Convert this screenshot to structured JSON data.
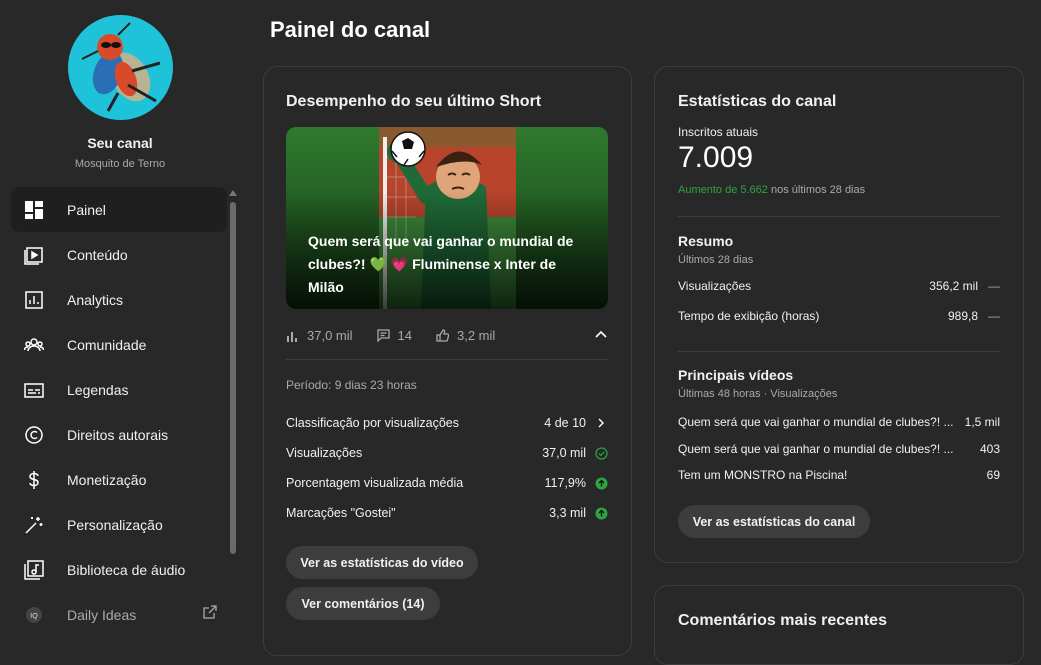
{
  "sidebar": {
    "channel_name": "Seu canal",
    "channel_handle": "Mosquito de Terno",
    "items": [
      {
        "label": "Painel",
        "icon": "dashboard-icon",
        "active": true
      },
      {
        "label": "Conteúdo",
        "icon": "content-icon"
      },
      {
        "label": "Analytics",
        "icon": "analytics-icon"
      },
      {
        "label": "Comunidade",
        "icon": "community-icon"
      },
      {
        "label": "Legendas",
        "icon": "subtitles-icon"
      },
      {
        "label": "Direitos autorais",
        "icon": "copyright-icon"
      },
      {
        "label": "Monetização",
        "icon": "dollar-icon"
      },
      {
        "label": "Personalização",
        "icon": "magic-wand-icon"
      },
      {
        "label": "Biblioteca de áudio",
        "icon": "audio-library-icon"
      },
      {
        "label": "Daily Ideas",
        "icon": "daily-ideas-icon",
        "external": true
      }
    ]
  },
  "page": {
    "title": "Painel do canal"
  },
  "short_card": {
    "title": "Desempenho do seu último Short",
    "thumbnail_caption": "Quem será que vai ganhar o mundial de clubes?! 💚 💗 Fluminense x Inter de Milão",
    "views": "37,0 mil",
    "comments": "14",
    "likes": "3,2 mil",
    "period": "Período: 9 dias 23 horas",
    "stats": [
      {
        "label": "Classificação por visualizações",
        "value": "4 de 10",
        "indicator": "chevron-right-icon"
      },
      {
        "label": "Visualizações",
        "value": "37,0 mil",
        "indicator": "check-circle-icon"
      },
      {
        "label": "Porcentagem visualizada média",
        "value": "117,9%",
        "indicator": "arrow-up-icon"
      },
      {
        "label": "Marcações \"Gostei\"",
        "value": "3,3 mil",
        "indicator": "arrow-up-icon"
      }
    ],
    "video_stats_button": "Ver as estatísticas do vídeo",
    "comments_button": "Ver comentários (14)"
  },
  "stats_card": {
    "title": "Estatísticas do canal",
    "subscribers_label": "Inscritos atuais",
    "subscribers": "7.009",
    "growth_highlight": "Aumento de 5.662",
    "growth_rest": " nos últimos 28 dias",
    "summary_title": "Resumo",
    "summary_sub": "Últimos 28 dias",
    "summary_rows": [
      {
        "label": "Visualizações",
        "value": "356,2 mil",
        "trend": "—"
      },
      {
        "label": "Tempo de exibição (horas)",
        "value": "989,8",
        "trend": "—"
      }
    ],
    "top_title": "Principais vídeos",
    "top_sub": "Últimas 48 horas · Visualizações",
    "top_rows": [
      {
        "label": "Quem será que vai ganhar o mundial de clubes?! ...",
        "value": "1,5 mil"
      },
      {
        "label": "Quem será que vai ganhar o mundial de clubes?! ...",
        "value": "403"
      },
      {
        "label": "Tem um MONSTRO na Piscina!",
        "value": "69"
      }
    ],
    "button": "Ver as estatísticas do canal"
  },
  "comments_card": {
    "title": "Comentários mais recentes"
  },
  "colors": {
    "accent_green": "#2ba640",
    "background": "#282828",
    "card_border": "#3d3d3d"
  }
}
